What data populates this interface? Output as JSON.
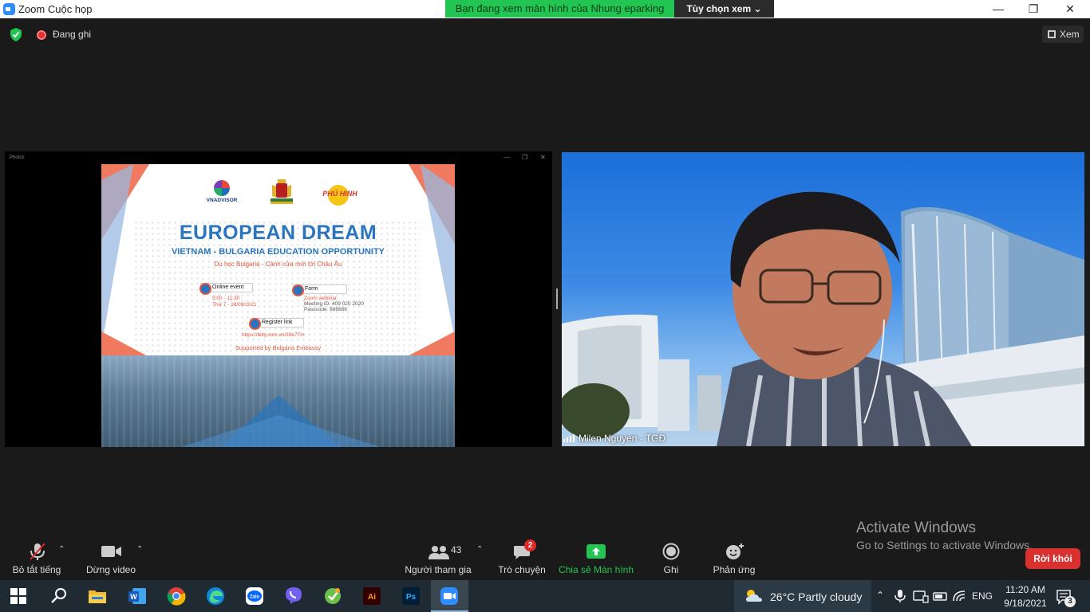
{
  "window": {
    "title": "Zoom Cuộc họp",
    "share_banner": "Bạn đang xem màn hình của Nhung eparking",
    "view_options": "Tùy chọn xem",
    "minimize": "—",
    "maximize": "❐",
    "close": "✕"
  },
  "topbar": {
    "recording_label": "Đang ghi",
    "view_label": "Xem"
  },
  "shared_screen": {
    "window_label": "Photos",
    "poster": {
      "logo_left": "VNADVISOR",
      "logo_right": "PHÚ HINH",
      "title": "EUROPEAN DREAM",
      "subtitle": "VIETNAM - BULGARIA EDUCATION OPPORTUNITY",
      "tagline": "Du học Bulgaria - Cánh cửa mới tới Châu Âu",
      "online_event_label": "Online event",
      "event_time": "9:00 - 11:30",
      "event_date": "Thứ 7 - 18/09/2021",
      "form_label": "Form",
      "form_line1": "Zoom webinar",
      "form_line2": "Meeting ID: 409 020 2020",
      "form_line3": "Passcode: 888888",
      "register_label": "Register link",
      "register_url": "https://bitly.com.vn/29e77m",
      "supported_by": "Supported by Bulgaria Embassy"
    }
  },
  "video": {
    "participant_name": "Milen  Nguyen - TGĐ"
  },
  "watermark": {
    "line1": "Activate Windows",
    "line2": "Go to Settings to activate Windows."
  },
  "toolbar": {
    "mute_label": "Bỏ tắt tiếng",
    "video_label": "Dừng video",
    "participants_label": "Người tham gia",
    "participants_count": "43",
    "chat_label": "Trò chuyện",
    "chat_badge": "2",
    "share_label": "Chia sẻ Màn hình",
    "record_label": "Ghi",
    "reactions_label": "Phản ứng",
    "leave_label": "Rời khỏi",
    "caret": "⌃",
    "share_color": "#23c552",
    "leave_color": "#d93030"
  },
  "taskbar": {
    "weather": "26°C  Partly cloudy",
    "language": "ENG",
    "time": "11:20 AM",
    "date": "9/18/2021",
    "notification_count": "3",
    "apps": [
      "start-icon",
      "search-icon",
      "file-explorer-icon",
      "word-icon",
      "chrome-icon",
      "edge-icon",
      "zalo-icon",
      "viber-icon",
      "green-app-icon",
      "illustrator-icon",
      "photoshop-icon",
      "zoom-icon"
    ]
  }
}
